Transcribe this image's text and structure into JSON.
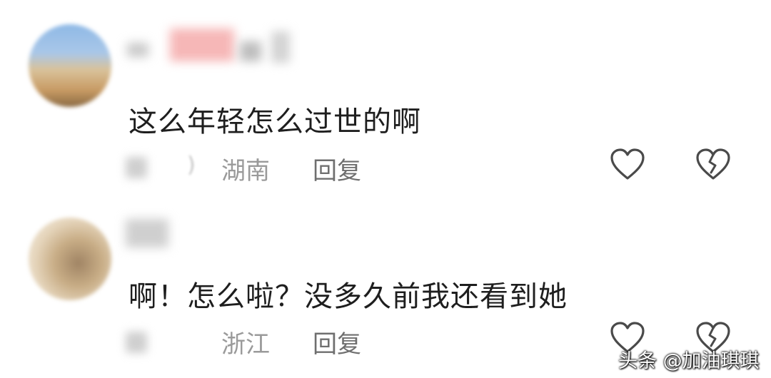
{
  "comments": [
    {
      "text": "这么年轻怎么过世的啊",
      "time_partial": ")",
      "location": "湖南",
      "reply_label": "回复"
    },
    {
      "text": "啊！怎么啦？没多久前我还看到她",
      "location": "浙江",
      "reply_label": "回复"
    }
  ],
  "icons": {
    "like": "heart-outline-icon",
    "dislike": "broken-heart-icon"
  },
  "watermark": "头条 @加油琪琪"
}
